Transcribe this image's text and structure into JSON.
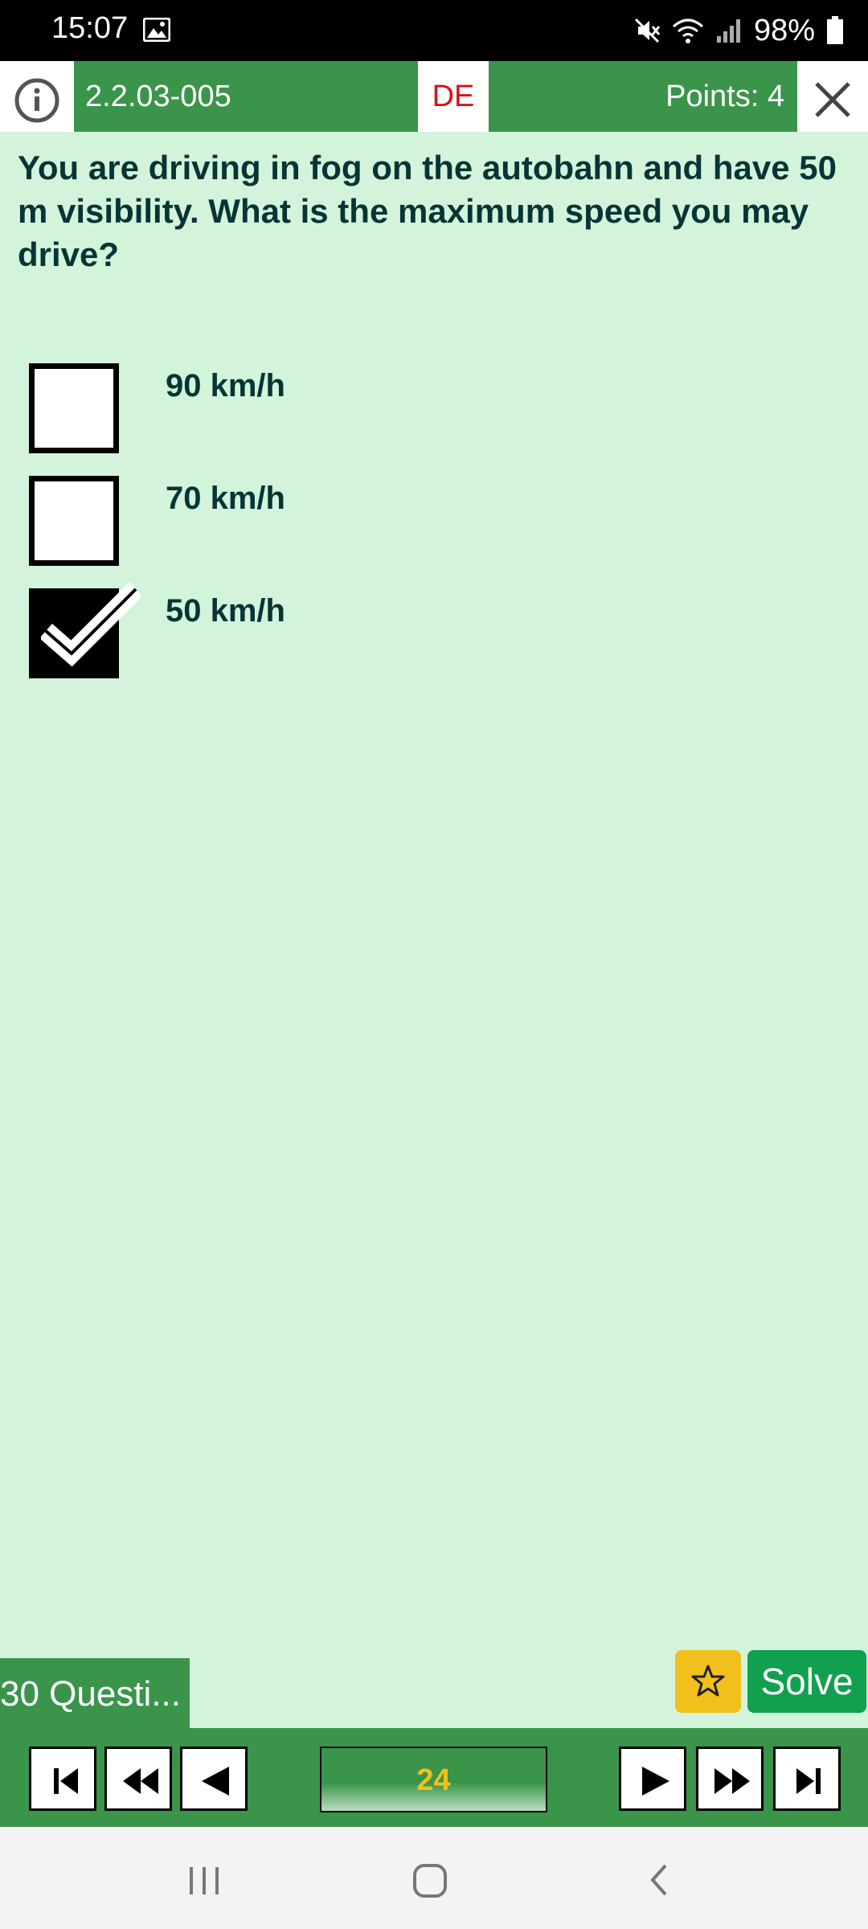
{
  "status_bar": {
    "time": "15:07",
    "battery": "98%"
  },
  "header": {
    "question_id": "2.2.03-005",
    "language": "DE",
    "points": "Points: 4"
  },
  "question": {
    "text": "You are driving in fog on the autobahn and have 50 m visibility. What is the maximum speed you may drive?"
  },
  "answers": [
    {
      "label": "90 km/h",
      "checked": false
    },
    {
      "label": "70 km/h",
      "checked": false
    },
    {
      "label": "50 km/h",
      "checked": true
    }
  ],
  "bottom": {
    "questions_tab": "30 Questi...",
    "solve": "Solve",
    "counter": "24"
  },
  "colors": {
    "header_green": "#3a954a",
    "background": "#d3f4db",
    "text": "#073535",
    "language_red": "#d31414",
    "favorite_yellow": "#f2c01c",
    "solve_green": "#11a14e"
  },
  "icons": [
    "image-icon",
    "mute-icon",
    "wifi-icon",
    "signal-icon",
    "battery-icon",
    "info-icon",
    "close-icon",
    "star-icon",
    "first-icon",
    "fast-back-icon",
    "back-icon",
    "forward-icon",
    "fast-forward-icon",
    "last-icon",
    "recents-icon",
    "home-icon",
    "system-back-icon"
  ]
}
